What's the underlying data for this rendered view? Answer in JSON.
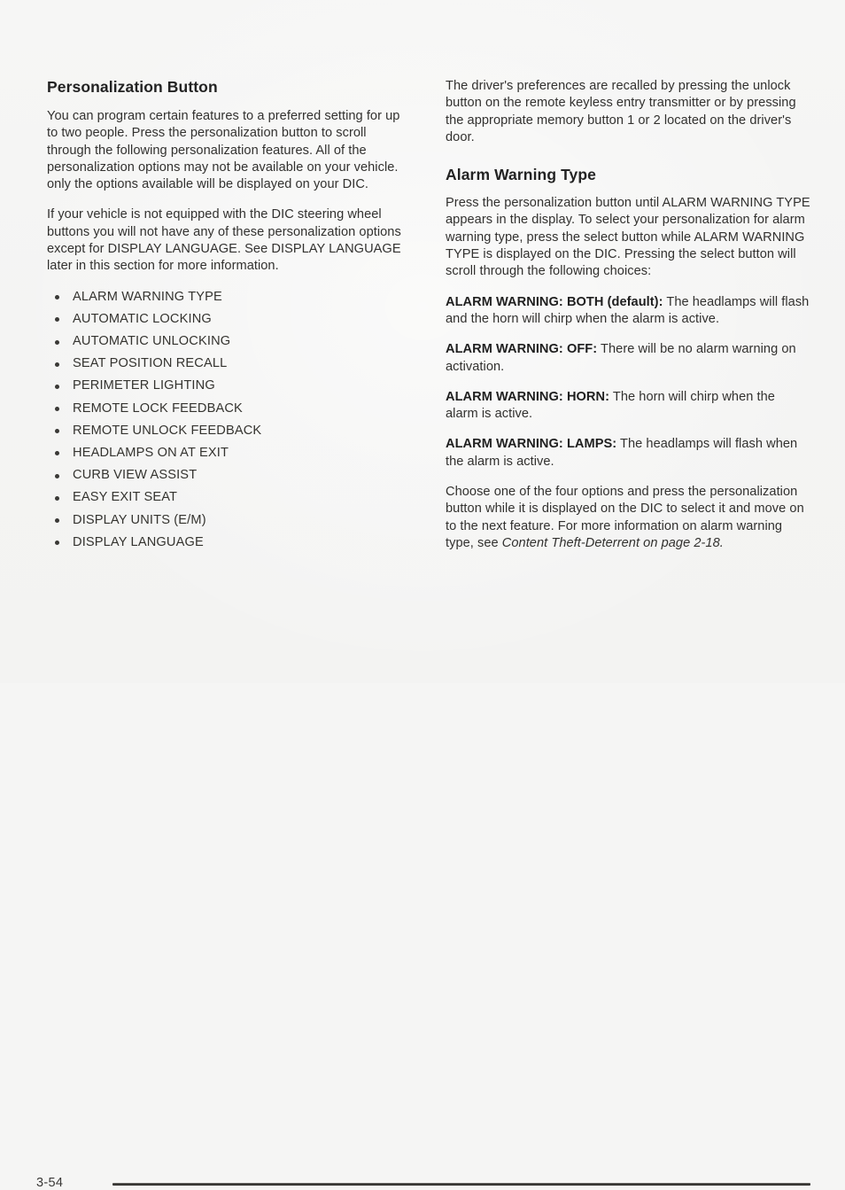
{
  "document": {
    "page_number": "3-54"
  },
  "left_column": {
    "heading": "Personalization Button",
    "paragraph_1": "You can program certain features to a preferred setting for up to two people. Press the personalization button to scroll through the following personalization features. All of the personalization options may not be available on your vehicle. only the options available will be displayed on your DIC.",
    "paragraph_2": "If your vehicle is not equipped with the DIC steering wheel buttons you will not have any of these personalization options except for DISPLAY LANGUAGE. See DISPLAY LANGUAGE later in this section for more information.",
    "features": [
      "ALARM WARNING TYPE",
      "AUTOMATIC LOCKING",
      "AUTOMATIC UNLOCKING",
      "SEAT POSITION RECALL",
      "PERIMETER LIGHTING",
      "REMOTE LOCK FEEDBACK",
      "REMOTE UNLOCK FEEDBACK",
      "HEADLAMPS ON AT EXIT",
      "CURB VIEW ASSIST",
      "EASY EXIT SEAT",
      "DISPLAY UNITS (E/M)",
      "DISPLAY LANGUAGE"
    ]
  },
  "right_column": {
    "paragraph_1": "The driver's preferences are recalled by pressing the unlock button on the remote keyless entry transmitter or by pressing the appropriate memory button 1 or 2 located on the driver's door.",
    "heading": "Alarm Warning Type",
    "paragraph_2": "Press the personalization button until ALARM WARNING TYPE appears in the display. To select your personalization for alarm warning type, press the select button while ALARM WARNING TYPE is displayed on the DIC. Pressing the select button will scroll through the following choices:",
    "choices": [
      {
        "lead": "ALARM WARNING: BOTH (default):",
        "text": " The headlamps will flash and the horn will chirp when the alarm is active."
      },
      {
        "lead": "ALARM WARNING: OFF:",
        "text": " There will be no alarm warning on activation."
      },
      {
        "lead": "ALARM WARNING: HORN:",
        "text": " The horn will chirp when the alarm is active."
      },
      {
        "lead": "ALARM WARNING: LAMPS:",
        "text": " The headlamps will flash when the alarm is active."
      }
    ],
    "closing_paragraph": {
      "text_before": "Choose one of the four options and press the personalization button while it is displayed on the DIC to select it and move on to the next feature. For more information on alarm warning type, see ",
      "cross_reference": "Content Theft-Deterrent on page 2-18."
    }
  }
}
